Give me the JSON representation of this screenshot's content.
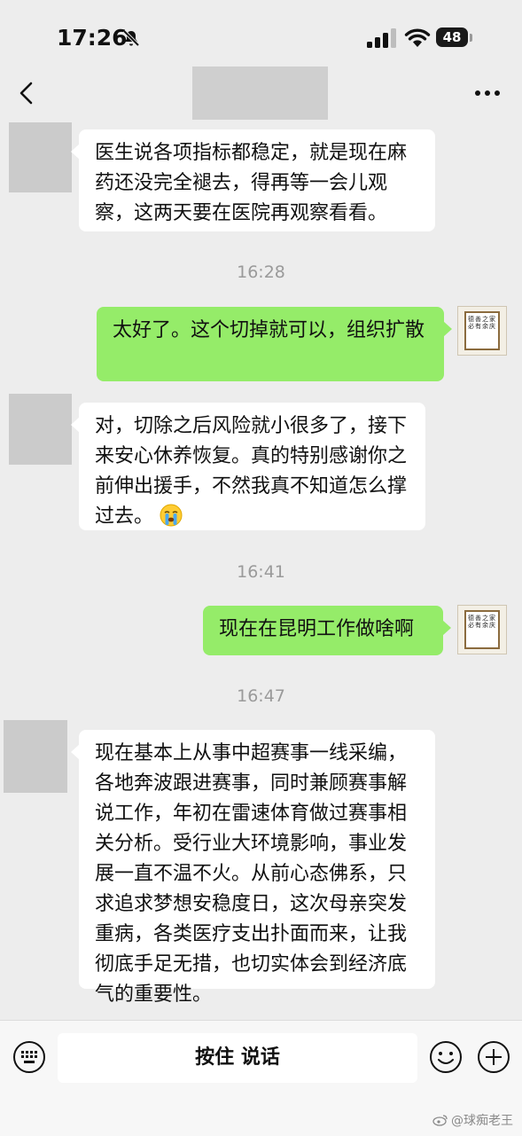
{
  "status_bar": {
    "time": "17:26",
    "battery": "48"
  },
  "header": {
    "title": ""
  },
  "messages": [
    {
      "side": "in",
      "text": "医生说各项指标都稳定，就是现在麻药还没完全褪去，得再等一会儿观察，这两天要在医院再观察看看。"
    },
    {
      "timestamp": "16:28"
    },
    {
      "side": "out",
      "text": "太好了。这个切掉就可以，组织扩散"
    },
    {
      "side": "in",
      "text": "对，切除之后风险就小很多了，接下来安心休养恢复。真的特别感谢你之前伸出援手，不然我真不知道怎么撑过去。"
    },
    {
      "timestamp": "16:41"
    },
    {
      "side": "out",
      "text": "现在在昆明工作做啥啊"
    },
    {
      "timestamp": "16:47"
    },
    {
      "side": "in",
      "text": "现在基本上从事中超赛事一线采编，各地奔波跟进赛事，同时兼顾赛事解说工作，年初在雷速体育做过赛事相关分析。受行业大环境影响，事业发展一直不温不火。从前心态佛系，只求追求梦想安稳度日，这次母亲突发重病，各类医疗支出扑面而来，让我彻底手足无措，也切实体会到经济底气的重要性。"
    }
  ],
  "self_avatar_text": "德善之家必有余庆",
  "input_bar": {
    "hold_to_talk": "按住 说话"
  },
  "watermark": "@球痴老王",
  "colors": {
    "outgoing_bubble": "#95ec69",
    "incoming_bubble": "#ffffff",
    "background": "#ededed"
  }
}
